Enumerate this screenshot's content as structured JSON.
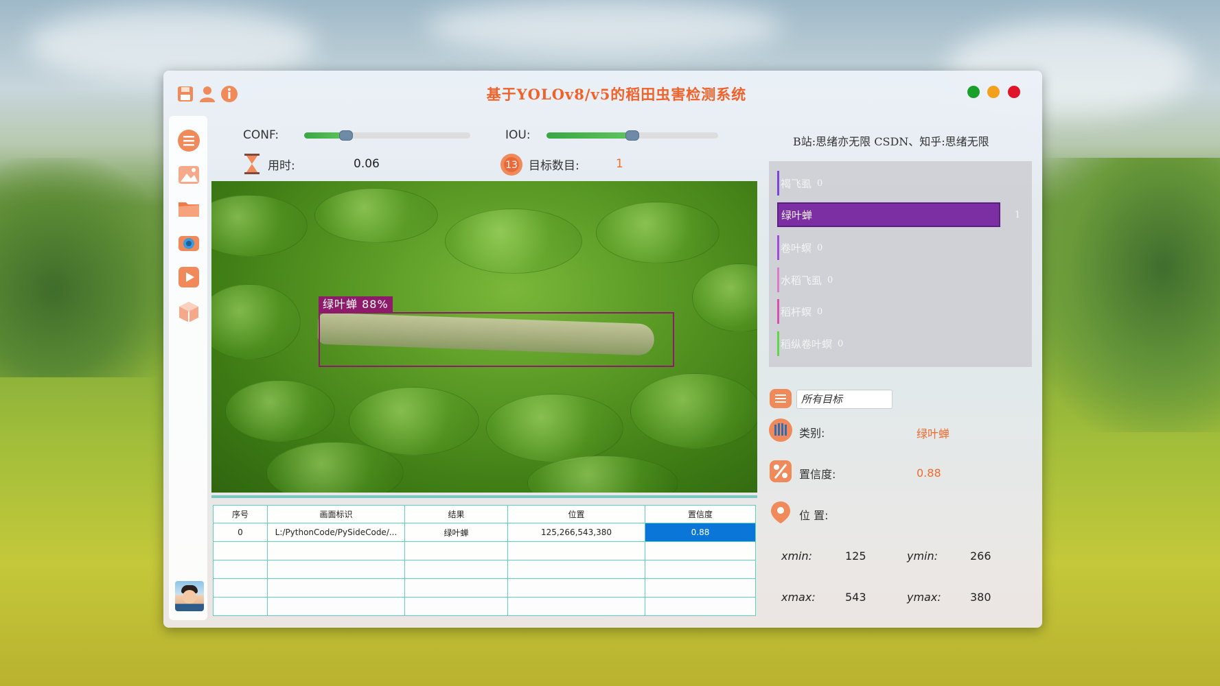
{
  "window": {
    "title": "基于YOLOv8/v5的稻田虫害检测系统"
  },
  "toolbar_icons": [
    "save-icon",
    "user-icon",
    "info-icon"
  ],
  "traffic_lights": {
    "green": "#1aa02a",
    "orange": "#f3a01b",
    "red": "#e1152a"
  },
  "sidebar": {
    "items": [
      "menu-icon",
      "image-icon",
      "folder-icon",
      "camera-icon",
      "video-play-icon",
      "model-cube-icon"
    ]
  },
  "controls": {
    "conf_label": "CONF:",
    "conf_value": 0.25,
    "iou_label": "IOU:",
    "iou_value": 0.5,
    "time_label": "用时:",
    "time_value": "0.06",
    "count_label": "目标数目:",
    "count_value": "1"
  },
  "detection": {
    "label": "绿叶蝉  88%"
  },
  "table": {
    "headers": [
      "序号",
      "画面标识",
      "结果",
      "位置",
      "置信度"
    ],
    "rows": [
      [
        "0",
        "L:/PythonCode/PySideCode/...",
        "绿叶蝉",
        "125,266,543,380",
        "0.88"
      ]
    ],
    "empty_rows": 4
  },
  "right_panel": {
    "header": "B站:思绪亦无限 CSDN、知乎:思绪无限",
    "classes": [
      {
        "name": "褐飞虱",
        "count": "0",
        "color": "#7a45d8"
      },
      {
        "name": "绿叶蝉",
        "count": "1",
        "color": "#7b2fa3"
      },
      {
        "name": "卷叶螟",
        "count": "0",
        "color": "#a34bd9"
      },
      {
        "name": "水稻飞虱",
        "count": "0",
        "color": "#e07ac8"
      },
      {
        "name": "稻杆螟",
        "count": "0",
        "color": "#d84fb0"
      },
      {
        "name": "稻纵卷叶螟",
        "count": "0",
        "color": "#5cd84a"
      }
    ],
    "select_value": "所有目标",
    "class_label": "类别:",
    "class_value": "绿叶蝉",
    "conf_label": "置信度:",
    "conf_value": "0.88",
    "pos_label": "位 置:",
    "xmin_label": "xmin:",
    "xmin": "125",
    "ymin_label": "ymin:",
    "ymin": "266",
    "xmax_label": "xmax:",
    "xmax": "543",
    "ymax_label": "ymax:",
    "ymax": "380"
  }
}
